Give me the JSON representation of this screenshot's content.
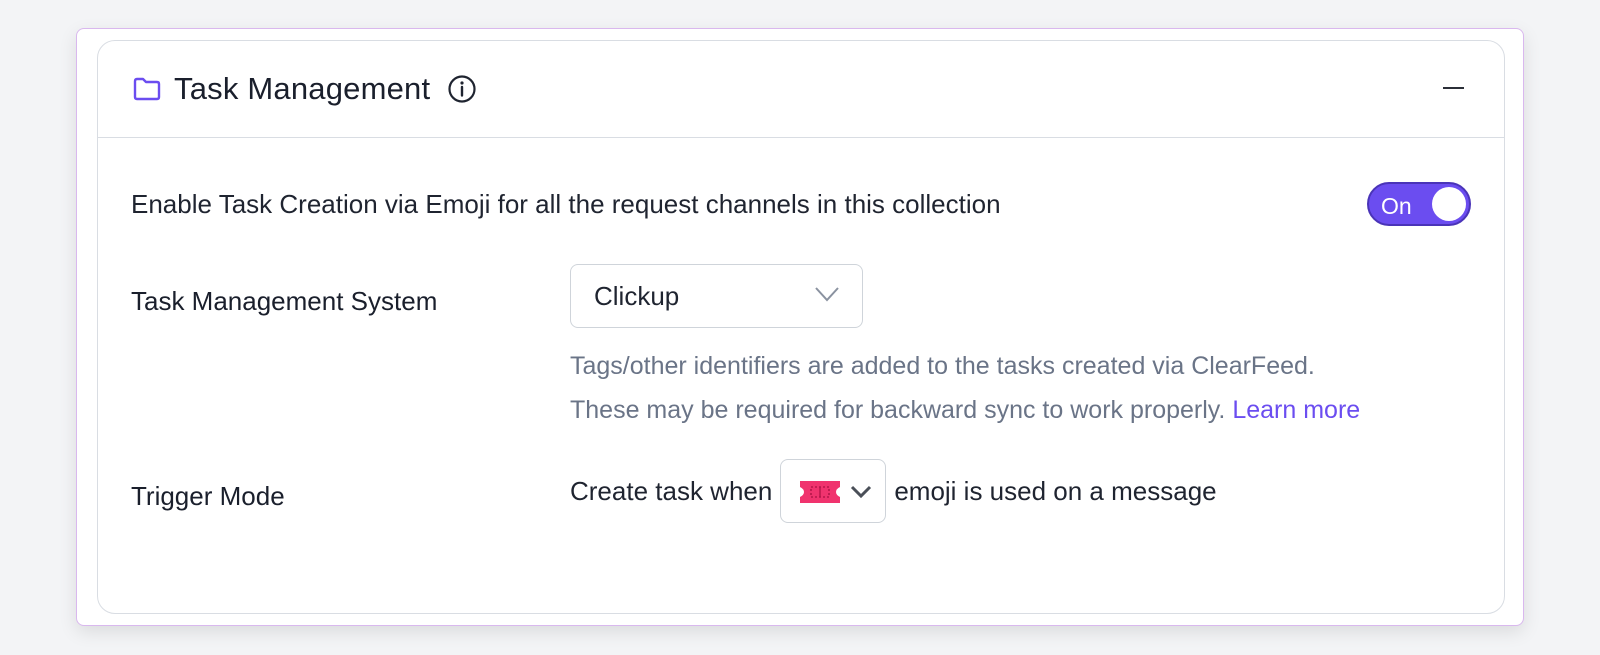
{
  "section": {
    "title": "Task Management",
    "icons": {
      "folder": "folder-icon",
      "info": "info-icon",
      "collapse": "minus-icon"
    },
    "accent_color": "#6b4df0"
  },
  "enable": {
    "label": "Enable Task Creation via Emoji for all the request channels in this collection",
    "toggle_label": "On",
    "toggle_state": "on"
  },
  "task_system": {
    "label": "Task Management System",
    "selected": "Clickup",
    "help_line1": "Tags/other identifiers are added to the tasks created via ClearFeed.",
    "help_line2": "These may be required for backward sync to work properly.",
    "learn_more": "Learn more"
  },
  "trigger": {
    "label": "Trigger Mode",
    "prefix": "Create task when",
    "emoji": "ticket-emoji",
    "suffix": "emoji is used on a message"
  }
}
